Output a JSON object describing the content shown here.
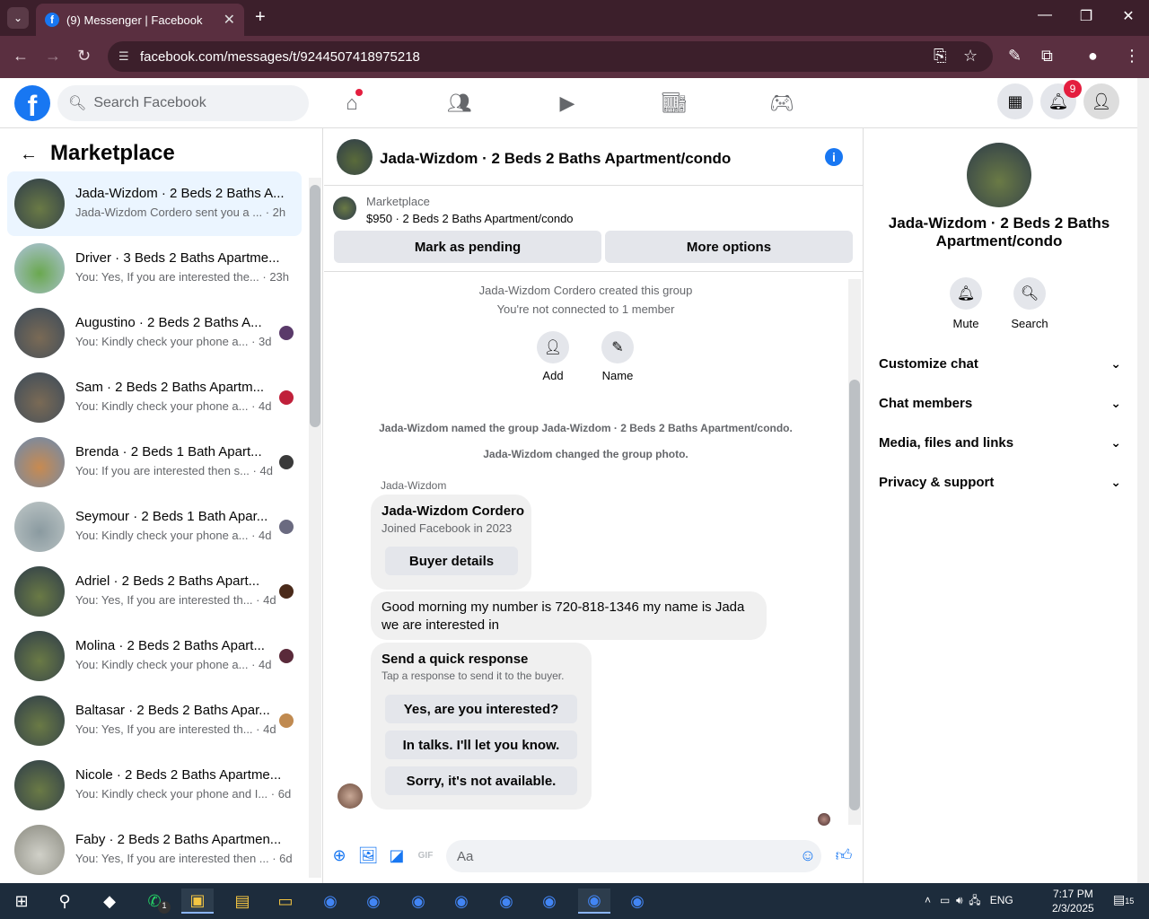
{
  "browser": {
    "tab_title": "(9) Messenger | Facebook",
    "url": "facebook.com/messages/t/9244507418975218"
  },
  "header": {
    "search_placeholder": "Search Facebook",
    "notification_count": "9"
  },
  "sidebar": {
    "title": "Marketplace",
    "conversations": [
      {
        "name": "Jada-Wizdom · 2 Beds 2 Baths A...",
        "snippet": "Jada-Wizdom Cordero sent you a ... · 2h",
        "active": true
      },
      {
        "name": "Driver · 3 Beds 2 Baths Apartme...",
        "snippet": "You: Yes, If you are interested the... · 23h"
      },
      {
        "name": "Augustino · 2 Beds 2 Baths A...",
        "snippet": "You: Kindly check your phone a... · 3d"
      },
      {
        "name": "Sam · 2 Beds 2 Baths Apartm...",
        "snippet": "You: Kindly check your phone a... · 4d"
      },
      {
        "name": "Brenda · 2 Beds 1 Bath Apart...",
        "snippet": "You: If you are interested then s... · 4d"
      },
      {
        "name": "Seymour · 2 Beds 1 Bath Apar...",
        "snippet": "You: Kindly check your phone a... · 4d"
      },
      {
        "name": "Adriel · 2 Beds 2 Baths Apart...",
        "snippet": "You: Yes, If you are interested th... · 4d"
      },
      {
        "name": "Molina · 2 Beds 2 Baths Apart...",
        "snippet": "You: Kindly check your phone a... · 4d"
      },
      {
        "name": "Baltasar · 2 Beds 2 Baths Apar...",
        "snippet": "You: Yes, If you are interested th... · 4d"
      },
      {
        "name": "Nicole · 2 Beds 2 Baths Apartme...",
        "snippet": "You: Kindly check your phone and I... · 6d"
      },
      {
        "name": "Faby · 2 Beds 2 Baths Apartmen...",
        "snippet": "You: Yes, If you are interested then ... · 6d"
      }
    ]
  },
  "chat": {
    "title": "Jada-Wizdom · 2 Beds 2 Baths Apartment/condo",
    "listing_category": "Marketplace",
    "listing_price": "$950 · 2 Beds 2 Baths Apartment/condo",
    "mark_pending": "Mark as pending",
    "more_options": "More options",
    "created": "Jada-Wizdom Cordero created this group",
    "not_connected": "You're not connected to 1 member",
    "add_label": "Add",
    "name_label": "Name",
    "named_event": "Jada-Wizdom named the group Jada-Wizdom · 2 Beds 2 Baths Apartment/condo.",
    "photo_event": "Jada-Wizdom changed the group photo.",
    "sender": "Jada-Wizdom",
    "profile_name": "Jada-Wizdom Cordero",
    "profile_joined": "Joined Facebook in 2023",
    "buyer_details": "Buyer details",
    "message1": "Good morning my number is 720-818-1346 my name is Jada we are interested in",
    "quick_title": "Send a quick response",
    "quick_sub": "Tap a response to send it to the buyer.",
    "quick_replies": [
      "Yes, are you interested?",
      "In talks. I'll let you know.",
      "Sorry, it's not available."
    ],
    "composer_placeholder": "Aa"
  },
  "right": {
    "title": "Jada-Wizdom · 2 Beds 2 Baths Apartment/condo",
    "mute": "Mute",
    "search": "Search",
    "sections": [
      "Customize chat",
      "Chat members",
      "Media, files and links",
      "Privacy & support"
    ]
  },
  "taskbar": {
    "lang": "ENG",
    "time": "7:17 PM",
    "date": "2/3/2025",
    "notif": "15",
    "whatsapp_badge": "1"
  },
  "colors": {
    "brand": "#1877f2",
    "badge": "#e41e3f"
  }
}
